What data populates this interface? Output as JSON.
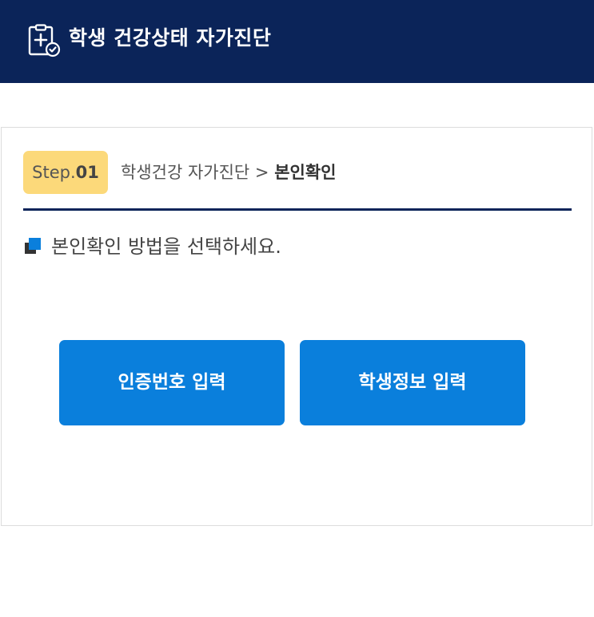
{
  "header": {
    "title": "학생 건강상태 자가진단",
    "icon": "clipboard-medical-check-icon",
    "background_color": "#0b2459"
  },
  "step": {
    "prefix": "Step.",
    "number": "01",
    "badge_color": "#fcd97a"
  },
  "breadcrumb": {
    "parent": "학생건강 자가진단 > ",
    "current": "본인확인"
  },
  "instruction": {
    "text": "본인확인 방법을 선택하세요.",
    "icon": "square-bullet-icon"
  },
  "buttons": {
    "cert_number": "인증번호 입력",
    "student_info": "학생정보 입력",
    "color": "#0a7fdc"
  }
}
